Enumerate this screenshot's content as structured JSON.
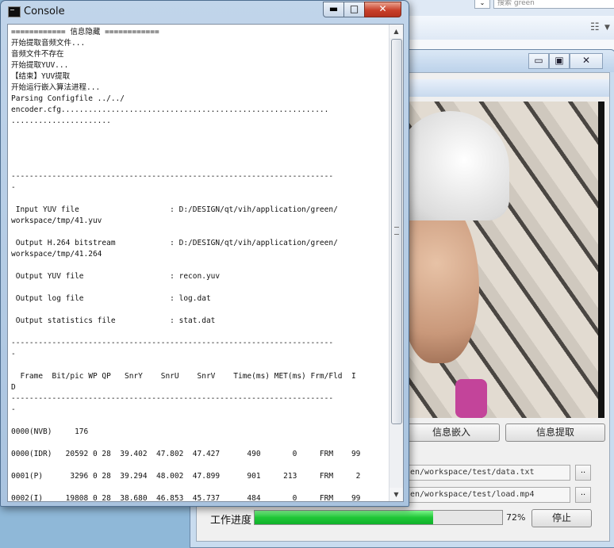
{
  "console": {
    "title": "Console",
    "minimize_glyph": "▬",
    "maximize_glyph": "□",
    "close_glyph": "✕",
    "lines": [
      "============ 信息隐藏 ============",
      "开始提取音频文件...",
      "音频文件不存在",
      "开始提取YUV...",
      "【结束】YUV提取",
      "开始运行嵌入算法进程...",
      "Parsing Configfile ../../",
      "encoder.cfg...........................................................",
      "......................",
      "",
      "",
      "",
      "",
      "-----------------------------------------------------------------------",
      "-",
      "",
      " Input YUV file                    : D:/DESIGN/qt/vih/application/green/",
      "workspace/tmp/41.yuv",
      "",
      " Output H.264 bitstream            : D:/DESIGN/qt/vih/application/green/",
      "workspace/tmp/41.264",
      "",
      " Output YUV file                   : recon.yuv",
      "",
      " Output log file                   : log.dat",
      "",
      " Output statistics file            : stat.dat",
      "",
      "-----------------------------------------------------------------------",
      "-",
      "",
      "  Frame  Bit/pic WP QP   SnrY    SnrU    SnrV    Time(ms) MET(ms) Frm/Fld  I",
      "D",
      "-----------------------------------------------------------------------",
      "-",
      "",
      "0000(NVB)     176",
      "",
      "0000(IDR)   20592 0 28  39.402  47.802  47.427      490       0     FRM    99",
      "",
      "0001(P)      3296 0 28  39.294  48.002  47.899      901     213     FRM     2",
      "",
      "0002(I)     19808 0 28  38.680  46.853  45.737      484       0     FRM    99"
    ],
    "scroll_up": "▲",
    "scroll_down": "▼"
  },
  "app": {
    "embed_button": "信息嵌入",
    "extract_button": "信息提取",
    "data_path": "en/workspace/test/data.txt",
    "load_path": "en/workspace/test/load.mp4",
    "browse_label": "..",
    "progress_label": "工作进度",
    "progress_value": 0.72,
    "progress_text": "72%",
    "stop_button": "停止",
    "minimize_glyph": "▭",
    "restore_glyph": "▣",
    "close_glyph": "✕"
  },
  "background": {
    "search_text": "搜索 green",
    "list_view_icon": "list-view-icon"
  }
}
